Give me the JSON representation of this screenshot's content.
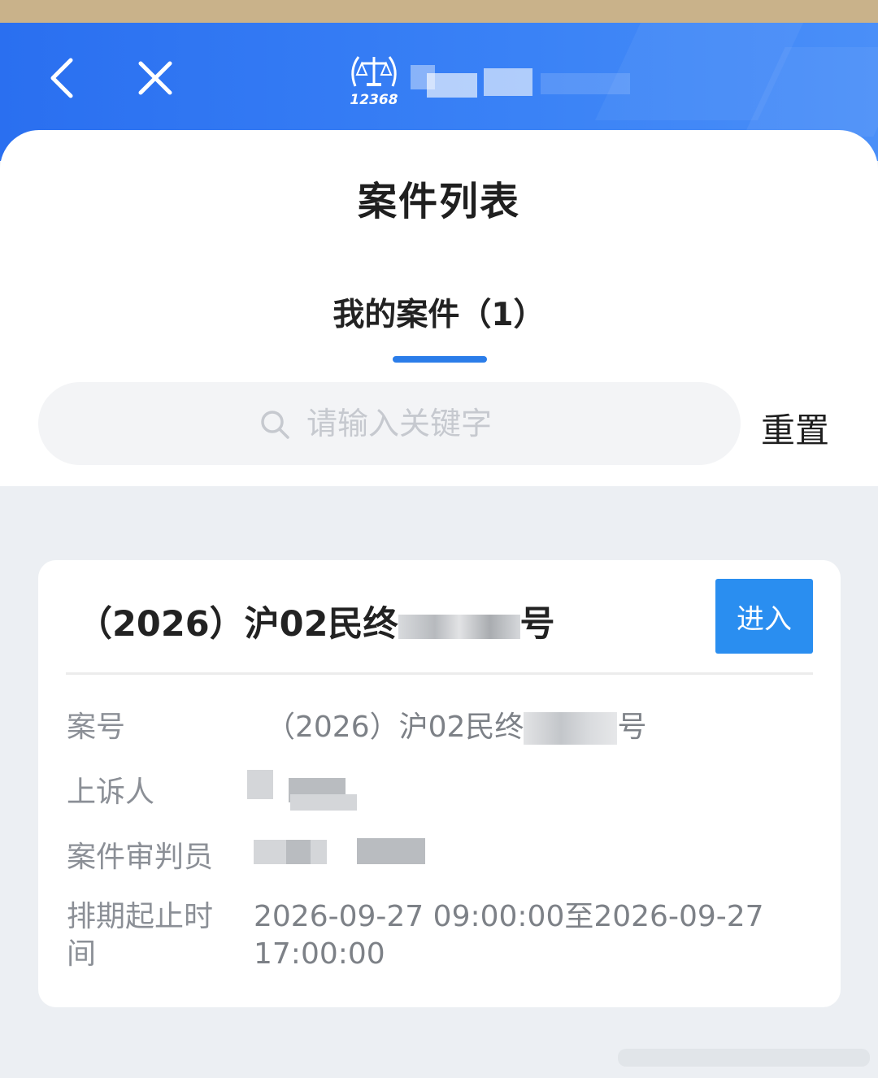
{
  "header": {
    "back_icon": "chevron-left-icon",
    "close_icon": "close-icon",
    "logo_text": "12368",
    "title": ""
  },
  "page": {
    "title": "案件列表"
  },
  "tabs": [
    {
      "label": "我的案件（1）",
      "active": true
    }
  ],
  "search": {
    "placeholder": "请输入关键字",
    "value": "",
    "reset_label": "重置"
  },
  "cases": [
    {
      "title": "（2026）沪02民终",
      "title_suffix": "号",
      "enter_label": "进入",
      "fields": {
        "case_no_label": "案号",
        "case_no_value": "（2026）沪02民终",
        "case_no_suffix": "号",
        "appellant_label": "上诉人",
        "judge_label": "案件审判员",
        "schedule_label_line1": "排期起止时",
        "schedule_label_line2": "间",
        "schedule_value_line1": "2026-09-27 09:00:00至2026-09-27",
        "schedule_value_line2": "17:00:00"
      }
    }
  ],
  "colors": {
    "header_blue": "#3a82f6",
    "accent_blue": "#2b7de9",
    "button_blue": "#2a8ef0",
    "page_bg": "#eceff3"
  }
}
